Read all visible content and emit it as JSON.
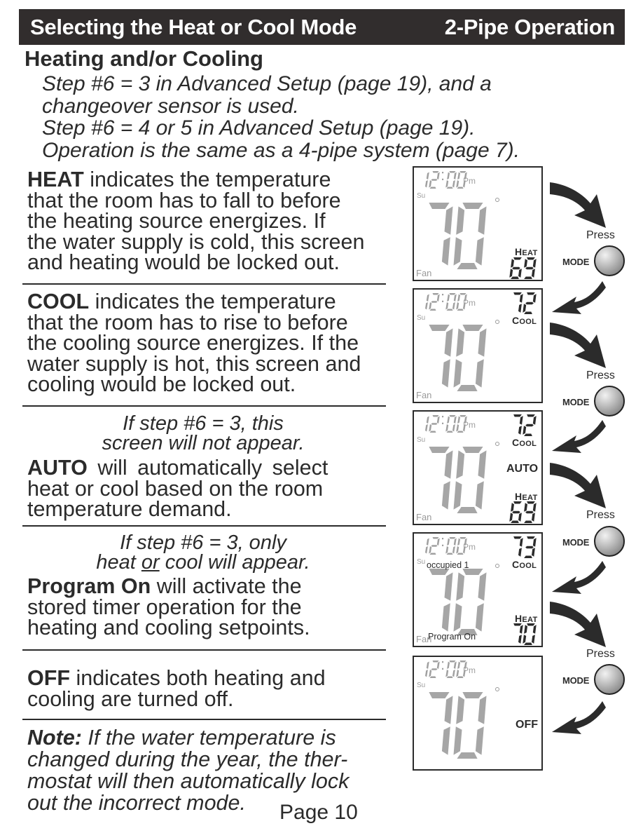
{
  "header": {
    "title": "Selecting the Heat or Cool Mode",
    "subtitle": "2-Pipe Operation"
  },
  "section_heading": "Heating and/or Cooling",
  "intro_lines": [
    "Step #6 = 3 in Advanced Setup (page 19), and a",
    "changeover sensor is used.",
    "Step #6 = 4 or 5 in Advanced Setup (page 19).",
    "Operation is the same as a 4-pipe system (page 7)."
  ],
  "modes": [
    {
      "keyword": "HEAT",
      "text_first": " indicates the temperature",
      "lines": [
        "that the room has to fall to before",
        "the heating source energizes.  If",
        "the water supply is cold, this screen",
        "and heating would be locked out."
      ]
    },
    {
      "keyword": "COOL",
      "text_first": " indicates the temperature",
      "lines": [
        "that the room has to rise to before",
        "the cooling source energizes.  If the",
        "water supply is hot, this screen and",
        "cooling would be locked out."
      ]
    },
    {
      "note_lines": [
        "If step #6 = 3, this",
        "screen will not appear."
      ],
      "keyword": "AUTO",
      "text_first": " will automatically select",
      "lines": [
        "heat or cool based on the room",
        "temperature demand."
      ]
    },
    {
      "note_prefix": "If step #6 = 3, only",
      "note_line2_a": "heat ",
      "note_line2_u": "or",
      "note_line2_b": " cool will appear.",
      "keyword": "Program On",
      "text_first": " will activate the",
      "lines": [
        "stored timer operation for the",
        "heating and cooling setpoints."
      ]
    },
    {
      "keyword": "OFF",
      "text_first": " indicates both heating and",
      "lines": [
        "cooling are turned off."
      ]
    }
  ],
  "note": {
    "label": "Note:",
    "text_first": "  If the water temperature is",
    "lines": [
      "changed during the year, the ther-",
      "mostat will then automatically lock",
      "out the incorrect mode."
    ]
  },
  "page_number": "Page 10",
  "lcd": {
    "time": "12:00",
    "ampm": "Pm",
    "day": "Su",
    "fan": "Fan",
    "room_temp": "70",
    "screens": [
      {
        "name": "heat",
        "heat_label": "HEAT",
        "heat_setpoint": "69"
      },
      {
        "name": "cool",
        "cool_label": "COOL",
        "cool_setpoint": "72"
      },
      {
        "name": "auto",
        "cool_label": "COOL",
        "cool_setpoint": "72",
        "mode": "AUTO",
        "heat_label": "HEAT",
        "heat_setpoint": "69"
      },
      {
        "name": "program",
        "cool_label": "COOL",
        "cool_setpoint": "73",
        "heat_label": "HEAT",
        "heat_setpoint": "70",
        "occupied": "occupied 1",
        "program": "Program On"
      },
      {
        "name": "off",
        "mode": "OFF"
      }
    ]
  },
  "controls": {
    "press_label": "Press",
    "mode_label": "MODE"
  },
  "colors": {
    "header_bg": "#312d2d",
    "text": "#2b2b2b",
    "lcd_dim": "#a0a0a0",
    "lcd_segment": "#a6a6a6"
  }
}
